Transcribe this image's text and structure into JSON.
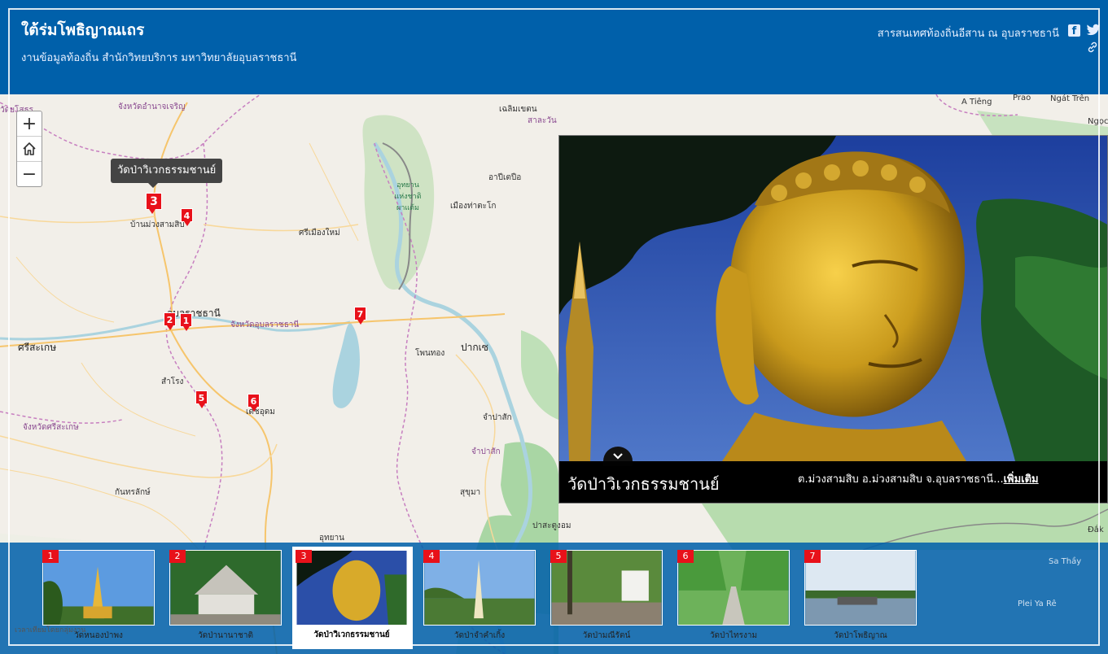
{
  "header": {
    "title": "ใต้ร่มโพธิญาณเถร",
    "subtitle": "งานข้อมูลท้องถิ่น สำนักวิทยบริการ มหาวิทยาลัยอุบลราชธานี",
    "right_text": "สารสนเทศท้องถิ่นอีสาน ณ อุบลราชธานี",
    "share_icons": [
      "facebook-icon",
      "twitter-icon",
      "link-icon"
    ]
  },
  "map": {
    "zoom_in": "+",
    "zoom_out": "−",
    "home_icon": "home-icon",
    "tooltip": "วัดป่าวิเวกธรรมชานย์",
    "places": {
      "amnat": "จังหวัดอำนาจเจริญ",
      "yasothon": "วัดยโสธร",
      "muang_sam_sip": "บ้านม่วงสามสิบ",
      "si_mueang_mai": "ศรีเมืองใหม่",
      "ubon": "อุบลราชธานี",
      "ubon_prov": "จังหวัดอุบลราชธานี",
      "sisaket": "ศรีสะเกษ",
      "sisaket_prov": "จังหวัดศรีสะเกษ",
      "sam_rong": "สำโรง",
      "det_udom": "เดชอุดม",
      "kanthararak": "กันทรลักษ์",
      "pakse": "ปากเซ",
      "champasak": "จำปาสัก",
      "champasak2": "จำปาสัก",
      "sukhuma": "สุขุมา",
      "phonthong": "โพนทอง",
      "salavan": "สาละวัน",
      "khongsedon": "เฉลิมเขตน",
      "lao_ngam": "อาปีเตปือ",
      "mueang_laongam": "เมืองท่าตะโก",
      "park": "อุทยาน แห่งชาติ ผาแต้ม",
      "pa_sak_chom": "ปาสะตูงอม",
      "a_tieng": "A Tiêng",
      "prao": "Prao",
      "ngat_tren": "Ngát Trên",
      "ngoc": "Ngọc",
      "sa_thay": "Sa Thầy",
      "plei_ya_re": "Plei Ya Rê",
      "dak": "Đắk",
      "khong_chiam": "อุทยาน"
    },
    "markers": [
      "1",
      "2",
      "3",
      "4",
      "5",
      "6",
      "7"
    ],
    "attribution": "เวลาเทียมโดยกลุ่มงาน"
  },
  "popup": {
    "title": "วัดป่าวิเวกธรรมชานย์",
    "description": "ต.ม่วงสามสิบ อ.ม่วงสามสิบ จ.อุบลราชธานี...",
    "more_link": "เพิ่มเติม",
    "collapse_icon": "chevron-down-icon"
  },
  "carousel": {
    "items": [
      {
        "num": "1",
        "label": "วัดหนองป่าพง"
      },
      {
        "num": "2",
        "label": "วัดป่านานาชาติ"
      },
      {
        "num": "3",
        "label": "วัดป่าวิเวกธรรมชานย์"
      },
      {
        "num": "4",
        "label": "วัดป่าจำคำเกิ้ง"
      },
      {
        "num": "5",
        "label": "วัดป่ามณีรัตน์"
      },
      {
        "num": "6",
        "label": "วัดป่าไทรงาม"
      },
      {
        "num": "7",
        "label": "วัดป่าโพธิญาณ"
      }
    ],
    "active_index": 2
  }
}
